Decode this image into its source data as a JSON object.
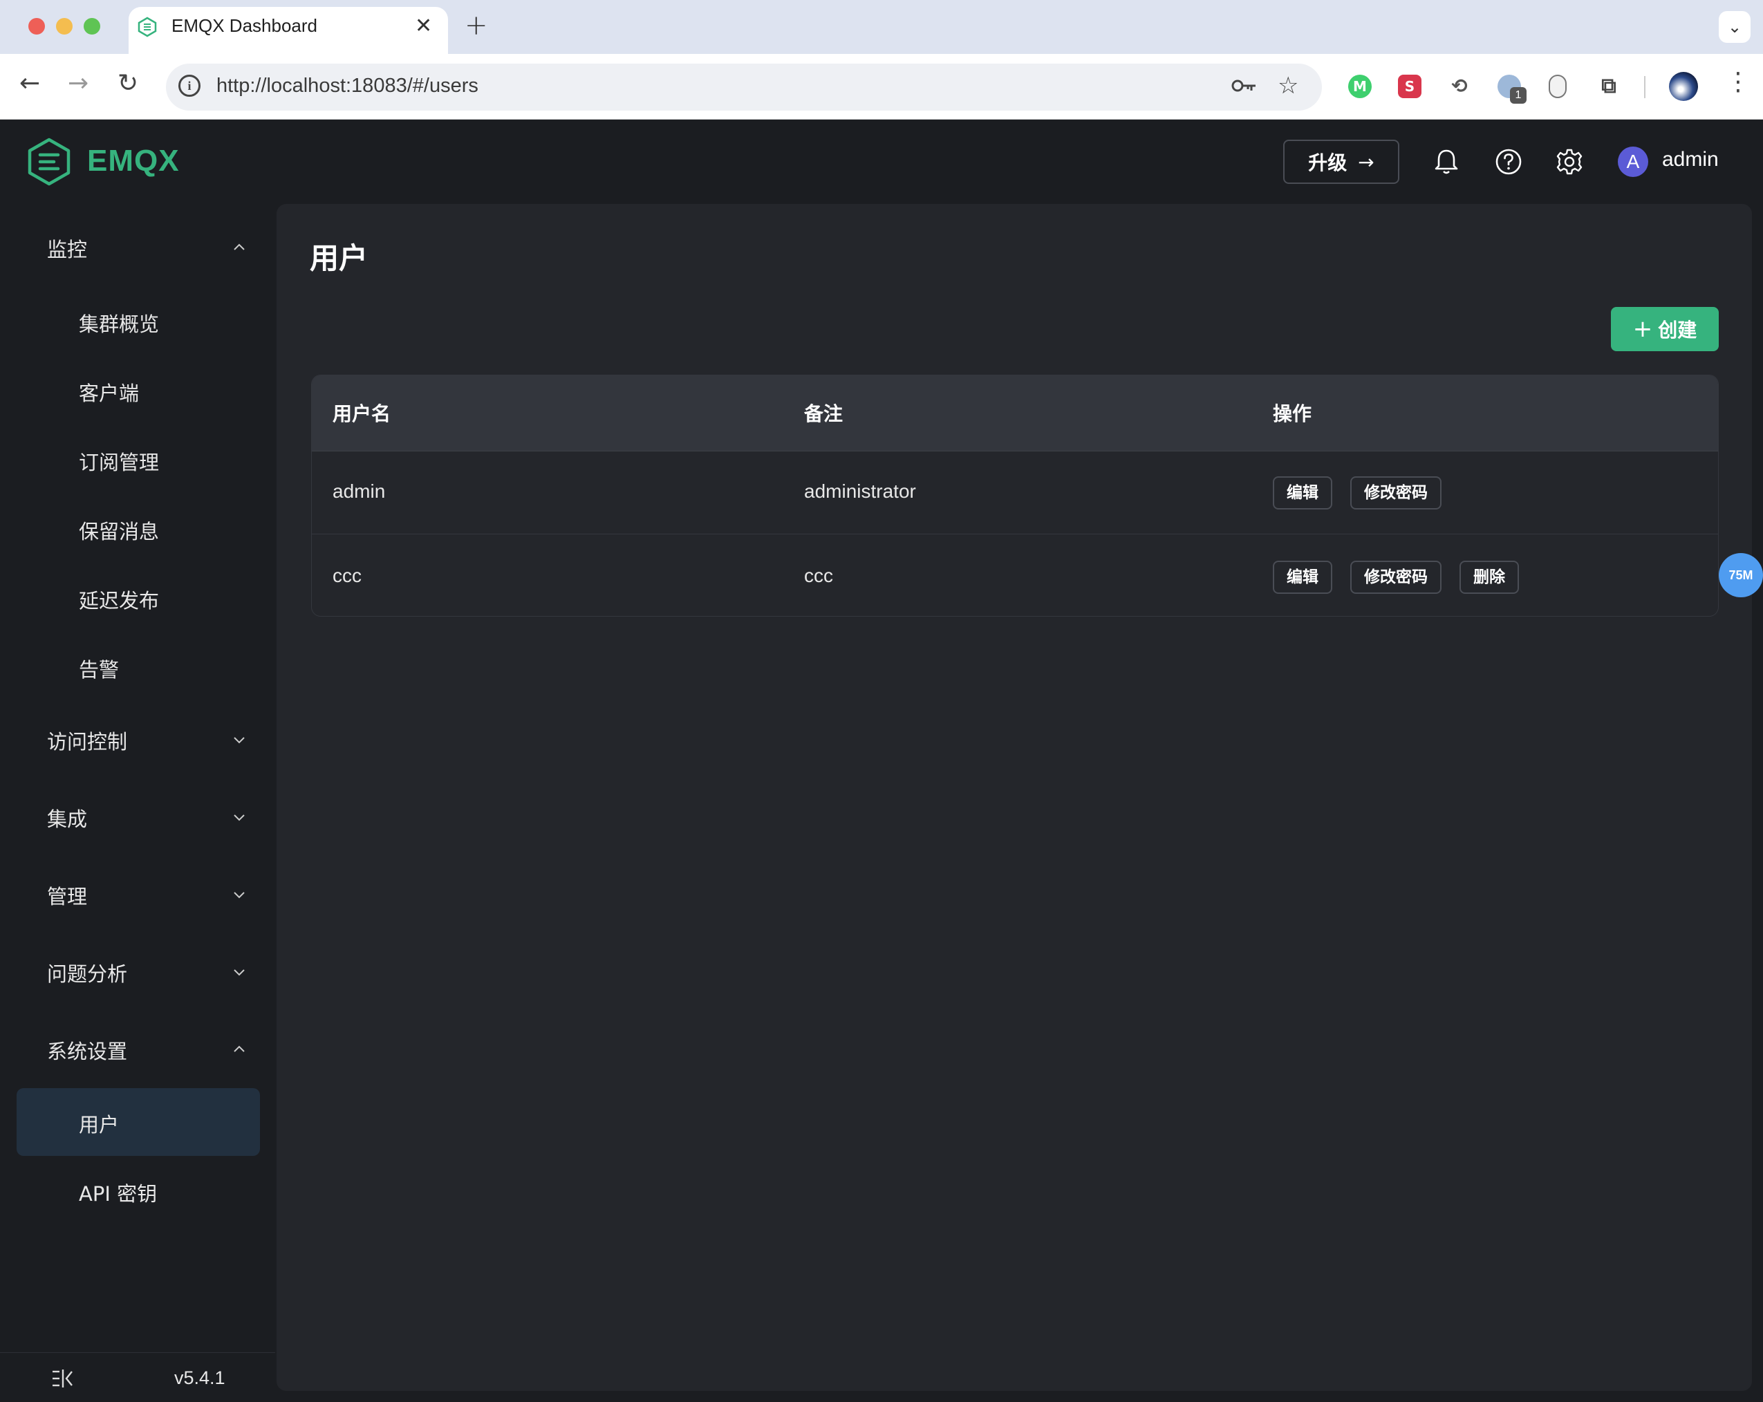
{
  "browser": {
    "tab_title": "EMQX Dashboard",
    "url": "http://localhost:18083/#/users",
    "ext_s_label": "S",
    "ext_badge": "1"
  },
  "header": {
    "logo_text": "EMQX",
    "upgrade_label": "升级",
    "user_initial": "A",
    "username": "admin",
    "brand_color": "#36b37e"
  },
  "sidebar": {
    "groups": [
      {
        "label": "监控",
        "expanded": true,
        "items": [
          "集群概览",
          "客户端",
          "订阅管理",
          "保留消息",
          "延迟发布",
          "告警"
        ]
      },
      {
        "label": "访问控制",
        "expanded": false
      },
      {
        "label": "集成",
        "expanded": false
      },
      {
        "label": "管理",
        "expanded": false
      },
      {
        "label": "问题分析",
        "expanded": false
      },
      {
        "label": "系统设置",
        "expanded": true,
        "items": [
          "用户",
          "API 密钥"
        ]
      }
    ],
    "active_item": "用户",
    "version": "v5.4.1"
  },
  "main": {
    "page_title": "用户",
    "create_label": "创建",
    "table": {
      "columns": [
        "用户名",
        "备注",
        "操作"
      ],
      "rows": [
        {
          "username": "admin",
          "note": "administrator",
          "actions": [
            "编辑",
            "修改密码"
          ]
        },
        {
          "username": "ccc",
          "note": "ccc",
          "actions": [
            "编辑",
            "修改密码",
            "删除"
          ]
        }
      ]
    }
  },
  "float_badge": "75M"
}
